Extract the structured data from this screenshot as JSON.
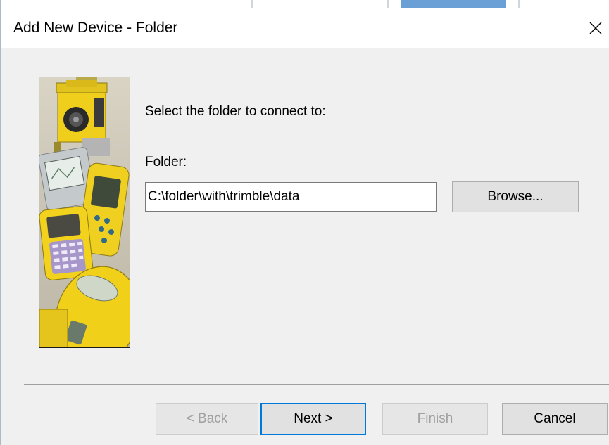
{
  "window": {
    "title": "Add New Device - Folder"
  },
  "icons": {
    "close": "close-icon",
    "illustration": "survey-devices-image"
  },
  "colors": {
    "default_button_border": "#0078d7",
    "dialog_background": "#f0f0f0",
    "disabled_text": "#a0a0a0"
  },
  "content": {
    "instruction": "Select the folder to connect to:",
    "folder_label": "Folder:",
    "folder_value": "C:\\folder\\with\\trimble\\data",
    "browse_label": "Browse..."
  },
  "buttons": {
    "back_label": "< Back",
    "next_label": "Next >",
    "finish_label": "Finish",
    "cancel_label": "Cancel"
  }
}
